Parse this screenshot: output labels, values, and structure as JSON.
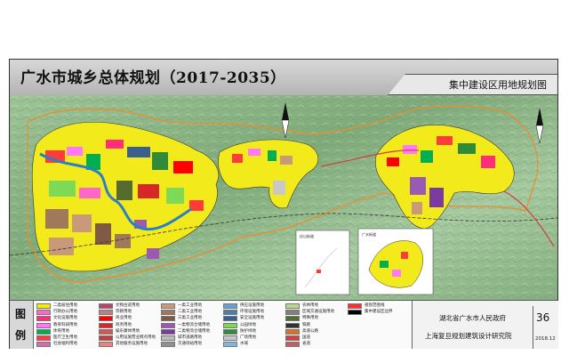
{
  "title": "广水市城乡总体规划（2017-2035）",
  "subtitle": "集中建设区用地规划图",
  "inset_labels": [
    "应山街道",
    "广水街道"
  ],
  "legend": {
    "head_chars": [
      "图",
      "例"
    ],
    "items": [
      {
        "label": "二类居住用地",
        "color": "#f5f000"
      },
      {
        "label": "行政办公用地",
        "color": "#ff66cc"
      },
      {
        "label": "文化设施用地",
        "color": "#ff2d7a"
      },
      {
        "label": "教育科研用地",
        "color": "#ff77ff"
      },
      {
        "label": "体育用地",
        "color": "#00b050"
      },
      {
        "label": "医疗卫生用地",
        "color": "#ff3b3b"
      },
      {
        "label": "社会福利用地",
        "color": "#d96ab0"
      },
      {
        "label": "文物古迹用地",
        "color": "#b4486a"
      },
      {
        "label": "宗教用地",
        "color": "#c08080"
      },
      {
        "label": "商业用地",
        "color": "#ff0000"
      },
      {
        "label": "商务用地",
        "color": "#d62828"
      },
      {
        "label": "娱乐康体用地",
        "color": "#e05050"
      },
      {
        "label": "公用设施营业网点用地",
        "color": "#c04040"
      },
      {
        "label": "其他服务设施用地",
        "color": "#f08080"
      },
      {
        "label": "一类工业用地",
        "color": "#c89a7a"
      },
      {
        "label": "二类工业用地",
        "color": "#a0785a"
      },
      {
        "label": "三类工业用地",
        "color": "#805a44"
      },
      {
        "label": "一类物流仓储用地",
        "color": "#9a5ab4"
      },
      {
        "label": "二类物流仓储用地",
        "color": "#7a3aa0"
      },
      {
        "label": "城市道路用地",
        "color": "#bdbdbd"
      },
      {
        "label": "交通场站用地",
        "color": "#909090"
      },
      {
        "label": "供应设施用地",
        "color": "#6aa0d0"
      },
      {
        "label": "环境设施用地",
        "color": "#4a80b0"
      },
      {
        "label": "安全设施用地",
        "color": "#3a6090"
      },
      {
        "label": "公园绿地",
        "color": "#7ed957"
      },
      {
        "label": "防护绿地",
        "color": "#2e8b3a"
      },
      {
        "label": "广场用地",
        "color": "#c8c8c8"
      },
      {
        "label": "水域",
        "color": "#7ab8e8"
      },
      {
        "label": "农林用地",
        "color": "#b8d890"
      },
      {
        "label": "区域交通设施用地",
        "color": "#808080"
      },
      {
        "label": "特殊用地",
        "color": "#556b2f"
      },
      {
        "label": "铁路",
        "color": "#333333"
      },
      {
        "label": "高速公路",
        "color": "#e07020"
      },
      {
        "label": "国道",
        "color": "#d04040"
      },
      {
        "label": "省道",
        "color": "#c06060"
      },
      {
        "label": "规划范围线",
        "color": "#ff3030"
      },
      {
        "label": "集中建设区边界",
        "color": "#000000"
      }
    ]
  },
  "institution": {
    "owner": "湖北省广水市人民政府",
    "designer": "上海复旦规划建筑设计研究院",
    "sheet_number": "36",
    "date": "2018.12"
  }
}
